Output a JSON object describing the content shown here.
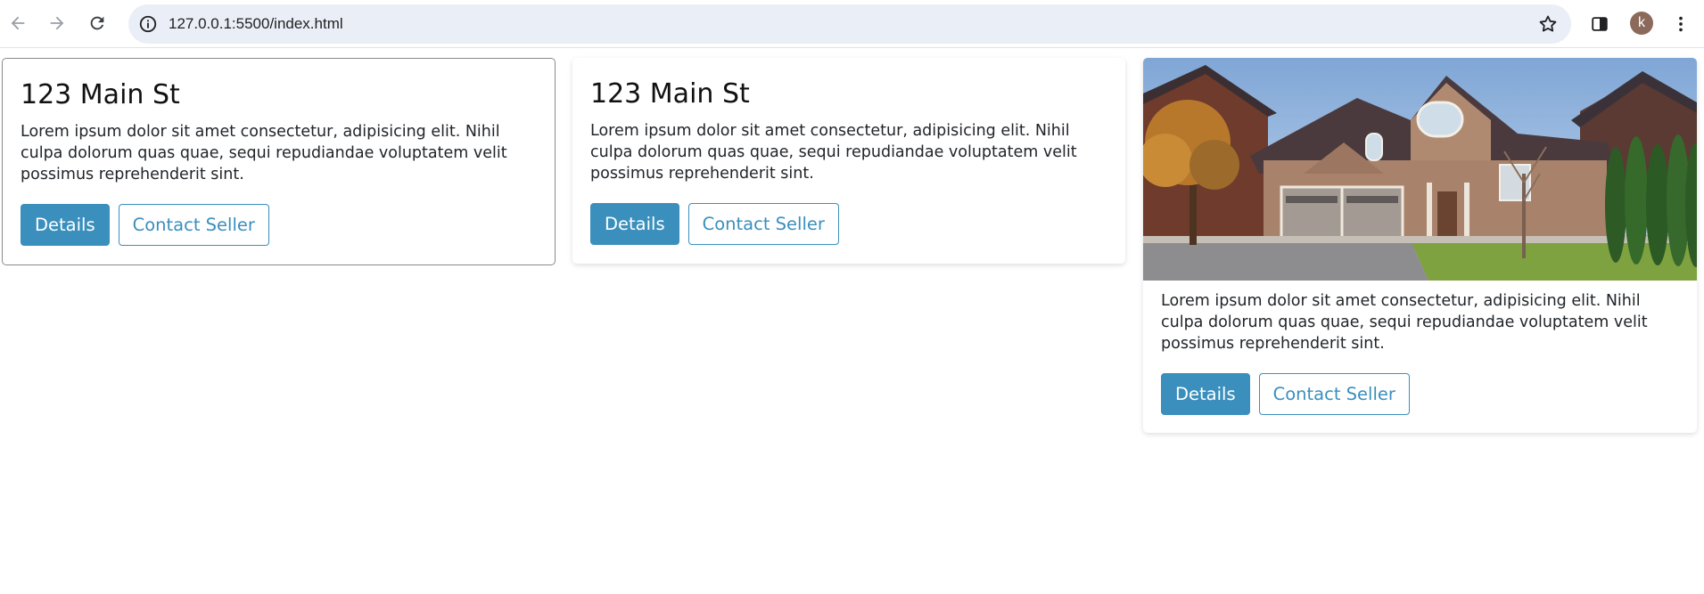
{
  "browser": {
    "url": "127.0.0.1:5500/index.html",
    "profile_initial": "k",
    "icons": {
      "back": "arrow-left-icon",
      "forward": "arrow-right-icon",
      "reload": "reload-icon",
      "site_info": "info-icon",
      "bookmark": "star-icon",
      "side_panel": "side-panel-icon",
      "menu": "kebab-menu-icon"
    }
  },
  "cards": [
    {
      "title": "123 Main St",
      "text": "Lorem ipsum dolor sit amet consectetur, adipisicing elit. Nihil culpa dolorum quas quae, sequi repudiandae voluptatem velit possimus reprehenderit sint.",
      "details_label": "Details",
      "contact_label": "Contact Seller"
    },
    {
      "title": "123 Main St",
      "text": "Lorem ipsum dolor sit amet consectetur, adipisicing elit. Nihil culpa dolorum quas quae, sequi repudiandae voluptatem velit possimus reprehenderit sint.",
      "details_label": "Details",
      "contact_label": "Contact Seller"
    },
    {
      "image": "house-photo",
      "text": "Lorem ipsum dolor sit amet consectetur, adipisicing elit. Nihil culpa dolorum quas quae, sequi repudiandae voluptatem velit possimus reprehenderit sint.",
      "details_label": "Details",
      "contact_label": "Contact Seller"
    }
  ],
  "colors": {
    "accent": "#3a8fbd",
    "omnibox": "#eaeef6",
    "avatar": "#8b6a5c"
  }
}
